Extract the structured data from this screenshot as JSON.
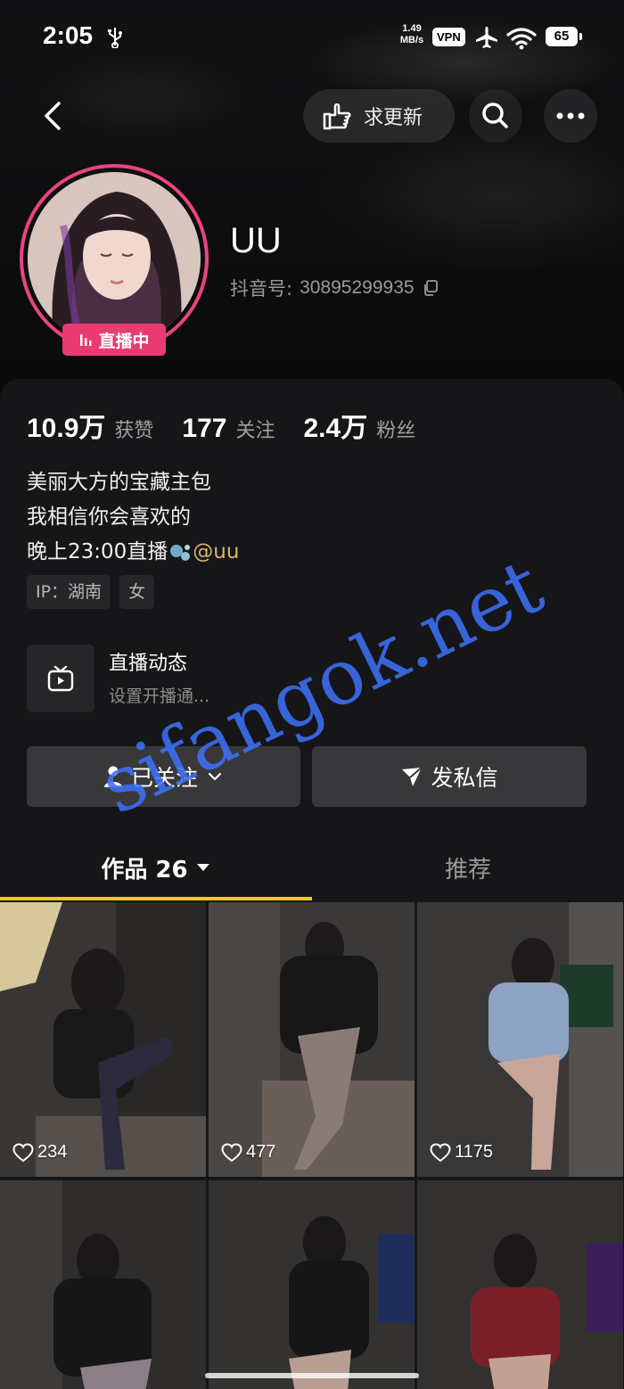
{
  "status_bar": {
    "time": "2:05",
    "net_speed_value": "1.49",
    "net_speed_unit": "MB/s",
    "vpn": "VPN",
    "battery": "65",
    "icons": [
      "usb-icon",
      "airplane-icon",
      "wifi-icon"
    ]
  },
  "nav": {
    "request_update_label": "求更新",
    "icons": [
      "back-arrow-icon",
      "hand-point-icon",
      "search-icon",
      "more-icon"
    ]
  },
  "profile": {
    "live_badge": "直播中",
    "nickname": "UU",
    "douyin_id_label": "抖音号:",
    "douyin_id_value": "30895299935"
  },
  "stats": [
    {
      "num": "10.9万",
      "label": "获赞"
    },
    {
      "num": "177",
      "label": "关注"
    },
    {
      "num": "2.4万",
      "label": "粉丝"
    }
  ],
  "bio": {
    "line1": "美丽大方的宝藏主包",
    "line2": "我相信你会喜欢的",
    "line3": "晚上23:00直播",
    "mention": "@uu"
  },
  "tags": [
    "IP：湖南",
    "女"
  ],
  "live_feed": {
    "title": "直播动态",
    "subtitle": "设置开播通..."
  },
  "actions": {
    "follow_label": "已关注",
    "message_label": "发私信"
  },
  "tabs": {
    "works_label": "作品 26",
    "recommend_label": "推荐"
  },
  "videos": [
    {
      "likes": "234"
    },
    {
      "likes": "477"
    },
    {
      "likes": "1175"
    },
    {
      "likes": ""
    },
    {
      "likes": ""
    },
    {
      "likes": ""
    }
  ],
  "watermark": "sifangok.net",
  "colors": {
    "live_pink": "#ea3a72",
    "tab_indicator": "#f4c723",
    "mention": "#d6b56e",
    "panel": "#161618"
  }
}
